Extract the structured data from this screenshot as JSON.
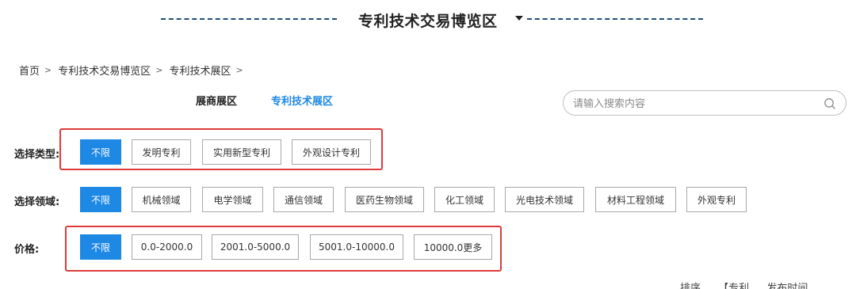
{
  "section": {
    "title": "专利技术交易博览区"
  },
  "breadcrumb": {
    "items": [
      "首页",
      "专利技术交易博览区",
      "专利技术展区"
    ],
    "separator": ">"
  },
  "tabs": [
    {
      "label": "展商展区",
      "active": false
    },
    {
      "label": "专利技术展区",
      "active": true
    }
  ],
  "search": {
    "placeholder": "请输入搜索内容",
    "value": "",
    "icon": "search-icon"
  },
  "filters": {
    "type": {
      "label": "选择类型:",
      "options": [
        "不限",
        "发明专利",
        "实用新型专利",
        "外观设计专利"
      ],
      "selected": "不限"
    },
    "field": {
      "label": "选择领域:",
      "options": [
        "不限",
        "机械领域",
        "电学领域",
        "通信领域",
        "医药生物领域",
        "化工领域",
        "光电技术领域",
        "材料工程领域",
        "外观专利"
      ],
      "selected": "不限"
    },
    "price": {
      "label": "价格:",
      "options": [
        "不限",
        "0.0-2000.0",
        "2001.0-5000.0",
        "5001.0-10000.0",
        "10000.0更多"
      ],
      "selected": "不限"
    }
  },
  "sort_bar_partial": {
    "label": "排序",
    "options": [
      "【专利",
      "发布时间"
    ]
  },
  "colors": {
    "accent": "#1e88e5",
    "highlight": "#e03b3b",
    "title_dash": "#1f4e79"
  }
}
